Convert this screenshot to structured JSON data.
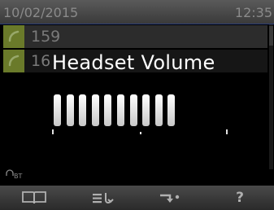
{
  "status_bar": {
    "date": "10/02/2015",
    "time": "12:35"
  },
  "call_list": [
    {
      "number": "159",
      "icon": "outgoing-call-icon"
    },
    {
      "number": "16",
      "icon": "outgoing-call-icon"
    }
  ],
  "volume_popup": {
    "title": "Headset Volume",
    "level": 10,
    "max": 10
  },
  "bluetooth": {
    "label": "BT",
    "icon": "headset-icon"
  },
  "softkeys": [
    {
      "icon": "directory-book-icon"
    },
    {
      "icon": "menu-list-icon"
    },
    {
      "icon": "forward-call-icon"
    },
    {
      "label": "?",
      "icon": "help-icon"
    }
  ],
  "colors": {
    "accent": "#6a7a2a",
    "status_text": "#8a8a8a",
    "popup_text": "#ffffff"
  }
}
